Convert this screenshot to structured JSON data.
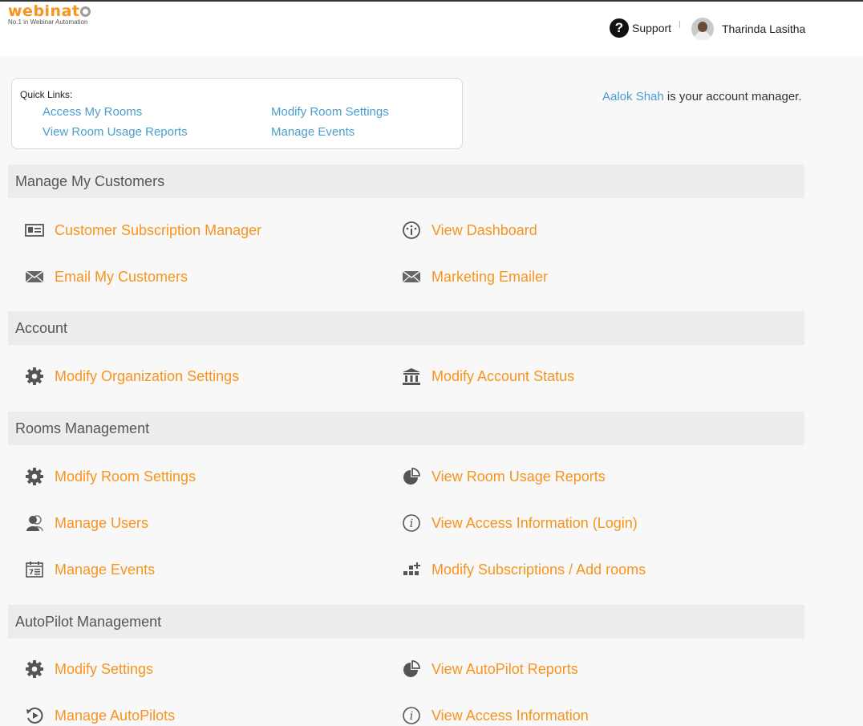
{
  "brand": {
    "name": "webinato",
    "tagline": "No.1 in Webinar Automation",
    "accent": "#f7941d",
    "link_color": "#4a9ecf"
  },
  "header": {
    "support_label": "Support",
    "user_name": "Tharinda Lasitha"
  },
  "quick_links": {
    "title": "Quick Links:",
    "links": [
      "Access My Rooms",
      "Modify Room Settings",
      "View Room Usage Reports",
      "Manage Events"
    ]
  },
  "account_manager": {
    "name": "Aalok Shah",
    "suffix": " is your account manager."
  },
  "sections": [
    {
      "title": "Manage My Customers",
      "items": [
        {
          "label": "Customer Subscription Manager",
          "icon": "id-card-icon"
        },
        {
          "label": "View Dashboard",
          "icon": "dashboard-gauge-icon"
        },
        {
          "label": "Email My Customers",
          "icon": "envelope-icon"
        },
        {
          "label": "Marketing Emailer",
          "icon": "envelope-icon"
        }
      ]
    },
    {
      "title": "Account",
      "items": [
        {
          "label": "Modify Organization Settings",
          "icon": "gear-icon"
        },
        {
          "label": "Modify Account Status",
          "icon": "bank-icon"
        }
      ]
    },
    {
      "title": "Rooms Management",
      "items": [
        {
          "label": "Modify Room Settings",
          "icon": "gear-icon"
        },
        {
          "label": "View Room Usage Reports",
          "icon": "pie-chart-icon"
        },
        {
          "label": "Manage Users",
          "icon": "users-icon"
        },
        {
          "label": "View Access Information (Login)",
          "icon": "info-icon"
        },
        {
          "label": "Manage Events",
          "icon": "calendar-icon"
        },
        {
          "label": "Modify Subscriptions / Add rooms",
          "icon": "add-blocks-icon"
        }
      ]
    },
    {
      "title": "AutoPilot Management",
      "items": [
        {
          "label": "Modify Settings",
          "icon": "gear-icon"
        },
        {
          "label": "View AutoPilot Reports",
          "icon": "pie-chart-icon"
        },
        {
          "label": "Manage AutoPilots",
          "icon": "play-cycle-icon"
        },
        {
          "label": "View Access Information",
          "icon": "info-icon"
        }
      ]
    }
  ]
}
